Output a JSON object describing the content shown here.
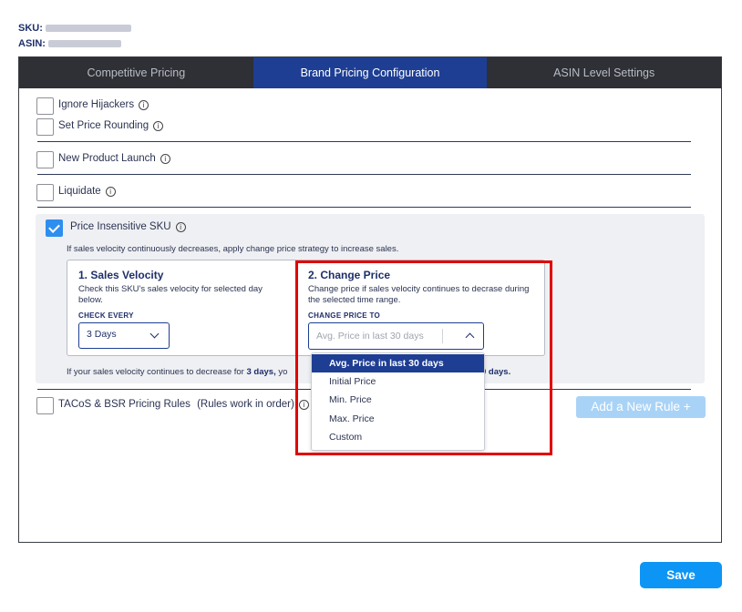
{
  "meta": {
    "sku_label": "SKU:",
    "asin_label": "ASIN:"
  },
  "tabs": [
    {
      "label": "Competitive Pricing",
      "active": false
    },
    {
      "label": "Brand Pricing Configuration",
      "active": true
    },
    {
      "label": "ASIN Level Settings",
      "active": false
    }
  ],
  "options": {
    "ignore_hijackers": {
      "label": "Ignore Hijackers",
      "checked": false
    },
    "set_price_rounding": {
      "label": "Set Price Rounding",
      "checked": false
    },
    "new_product_launch": {
      "label": "New Product Launch",
      "checked": false
    },
    "liquidate": {
      "label": "Liquidate",
      "checked": false
    },
    "price_insensitive": {
      "label": "Price Insensitive SKU",
      "checked": true,
      "description": "If sales velocity continuously decreases, apply change price strategy to increase sales.",
      "sales_velocity": {
        "title": "1. Sales Velocity",
        "description": "Check this SKU's sales velocity for selected day below.",
        "field_label": "CHECK EVERY",
        "value": "3 Days"
      },
      "change_price": {
        "title": "2. Change Price",
        "description": "Change price if sales velocity continues to decrase during the selected time range.",
        "field_label": "CHANGE PRICE TO",
        "placeholder": "Avg. Price in last 30 days",
        "options": [
          "Avg. Price in last 30 days",
          "Initial Price",
          "Min. Price",
          "Max. Price",
          "Custom"
        ],
        "highlighted": "Avg. Price in last 30 days"
      },
      "footnote_prefix": "If your sales velocity continues to decrease for",
      "footnote_days": "3 days,",
      "footnote_visible_tail_fragment": "yo",
      "footnote_end_days": "0 days."
    },
    "tacos_bsr": {
      "label": "TACoS & BSR Pricing Rules",
      "sublabel": "(Rules work in order)",
      "checked": false
    }
  },
  "add_rule_label": "Add a New Rule +",
  "save_label": "Save",
  "icons": {
    "info": "info-icon",
    "check": "check-icon",
    "chevron": "chevron-icon"
  },
  "colors": {
    "tab_active": "#1e3e93",
    "tab_bar": "#2e3035",
    "save": "#0d95f5",
    "highlight": "#e00000",
    "add_rule": "#a9d3f6"
  }
}
